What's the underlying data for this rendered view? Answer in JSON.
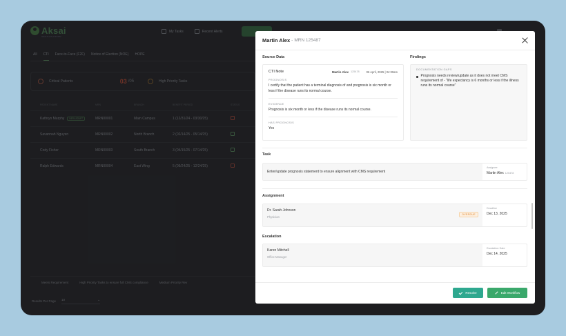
{
  "app": {
    "logo_text": "Aksai",
    "logo_sub": "HEALTH PLATFORM",
    "nav": [
      "My Tasks",
      "Recent Alerts"
    ],
    "tabs": [
      "All",
      "CTI",
      "Face-to-Face (F2F)",
      "Notice of Election (NOE)",
      "HOPE"
    ],
    "summary": {
      "critical_label": "Critical Patients",
      "critical_count": "03",
      "critical_of": "/05",
      "high_label": "High Priority Tasks"
    },
    "table": {
      "headers": [
        "Patient Name",
        "MRN",
        "Branch",
        "Benefit Period",
        "Status"
      ],
      "rows": [
        {
          "name": "Kathryn Murphy",
          "tag": "NEW ADMIT",
          "mrn": "MRN00001",
          "branch": "Main Campus",
          "period": "1 (12/31/24 - 03/30/25)"
        },
        {
          "name": "Savannah Nguyen",
          "tag": "",
          "mrn": "MRN00002",
          "branch": "North Branch",
          "period": "2 (02/14/25 - 05/14/25)"
        },
        {
          "name": "Cody Fisher",
          "tag": "",
          "mrn": "MRN00003",
          "branch": "South Branch",
          "period": "3 (04/15/25 - 07/14/25)"
        },
        {
          "name": "Ralph Edwards",
          "tag": "",
          "mrn": "MRN00004",
          "branch": "East Wing",
          "period": "5 (09/24/25 - 12/24/25)"
        }
      ]
    },
    "legend": [
      "Meets Requirement",
      "High Priority Tasks to ensure full CMS compliance",
      "Medium Priority Rev"
    ],
    "pager": {
      "label": "Results Per Page",
      "value": "10"
    }
  },
  "modal": {
    "patient_name": "Martin Alex",
    "separator": "-",
    "mrn": "MRN 125487",
    "source_title": "Source Data",
    "findings_title": "Findings",
    "note": {
      "title": "CTI Note",
      "author": "Martin Alex",
      "author_id": "125478",
      "date": "06 April, 2025 | 04:30am",
      "prognosis_label": "PROGNOSIS",
      "prognosis_text": "I certify that the patient has a terminal diagnosis of and prognosis is six month or less if the disease runs its normal course.",
      "evidence_label": "EVIDENCE",
      "evidence_text": "Prognosis is six month or less if the disease runs its normal course.",
      "has_prognosis_label": "HAS PROGNOSIS",
      "has_prognosis_value": "Yes"
    },
    "findings": {
      "label": "DOCUMENTATION GAPS",
      "items": [
        "Prognosis needs review/update as it does not meet CMS requirement of - \"life expectancy is 6 months or less if the illness runs its normal course\""
      ]
    },
    "task": {
      "title": "Task",
      "description": "Enter/update prognosis statement to ensure alignment with CMS requirement",
      "assignee_label": "Assignee",
      "assignee_name": "Martin Alex",
      "assignee_id": "125478"
    },
    "assignment": {
      "title": "Assignment",
      "name": "Dr. Sarah Johnson",
      "role": "Physician",
      "status": "OVERDUE",
      "deadline_label": "Deadline",
      "deadline": "Dec 13, 2025"
    },
    "escalation": {
      "title": "Escalation",
      "name": "Karen Mitchell",
      "role": "Office Manager",
      "date_label": "Escalation Date",
      "date": "Dec 14, 2025"
    },
    "buttons": {
      "resolve": "Resolve",
      "edit": "Edit Workflow"
    }
  },
  "colors": {
    "primary": "#2ea88f",
    "overdue": "#e0852b",
    "backdrop": "#a8cbe0"
  }
}
